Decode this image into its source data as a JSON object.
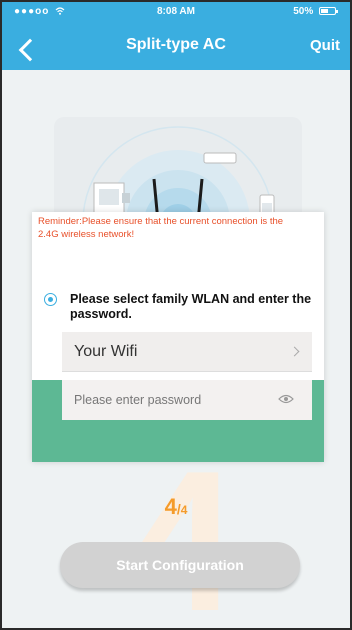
{
  "status_bar": {
    "carrier": "●●●oo",
    "time": "8:08 AM",
    "battery": "50%"
  },
  "nav": {
    "title": "Split-type AC",
    "quit_label": "Quit"
  },
  "instruction": {
    "text": "Please select family WLAN and enter the password."
  },
  "wifi_field": {
    "value": "Your Wifi"
  },
  "password_field": {
    "placeholder": "Please enter password"
  },
  "reminder": {
    "text": "Reminder:Please ensure that the current connection is the 2.4G wireless network!"
  },
  "step": {
    "current": "4",
    "separator": "/",
    "total": "4",
    "watermark": "4"
  },
  "start_button": {
    "label": "Start Configuration"
  },
  "colors": {
    "header": "#3aaee0",
    "green_band": "#5db894",
    "reminder": "#e8502a",
    "step": "#f49b2a"
  }
}
